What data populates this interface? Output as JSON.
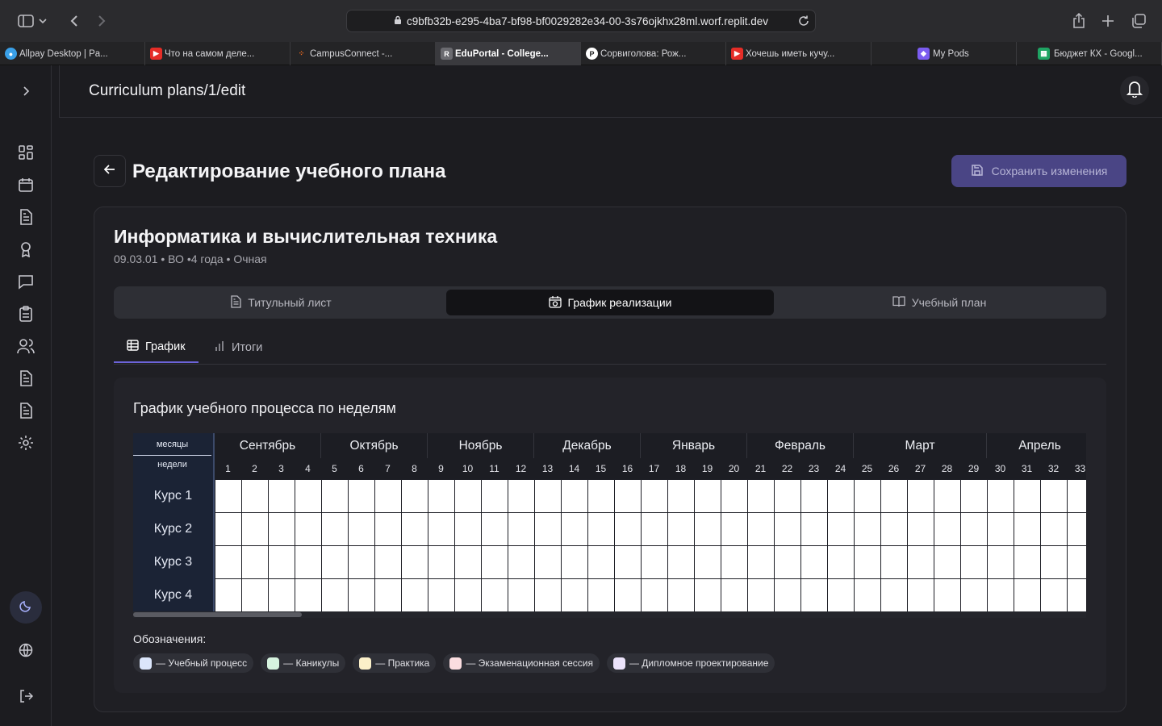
{
  "browser": {
    "url": "c9bfb32b-e295-4ba7-bf98-bf0029282e34-00-3s76ojkhx28ml.worf.replit.dev",
    "tabs": [
      {
        "title": "Allpay Desktop | Pa...",
        "icon": "allpay-icon",
        "color": "#3aa0e8"
      },
      {
        "title": "Что на самом деле...",
        "icon": "youtube-icon",
        "color": "#e52d27"
      },
      {
        "title": "CampusConnect -...",
        "icon": "campus-icon",
        "color": "#f26b1d"
      },
      {
        "title": "EduPortal - College...",
        "icon": "replit-icon",
        "color": "#6b6b70",
        "active": true
      },
      {
        "title": "Сорвиголова: Рож...",
        "icon": "reader-icon",
        "color": "#ffffff"
      },
      {
        "title": "Хочешь иметь кучу...",
        "icon": "youtube-icon",
        "color": "#e52d27"
      },
      {
        "title": "My Pods",
        "icon": "pods-icon",
        "color": "#7b5cf0"
      },
      {
        "title": "Бюджет КХ - Googl...",
        "icon": "sheets-icon",
        "color": "#1fa463"
      }
    ]
  },
  "app": {
    "breadcrumb": "Curriculum plans/1/edit",
    "page_title": "Редактирование учебного плана",
    "save_label": "Сохранить изменения",
    "program": {
      "name": "Информатика и вычислительная техника",
      "meta": "09.03.01 • ВО •4 года • Очная"
    },
    "sections": [
      {
        "label": "Титульный лист",
        "icon": "document-icon"
      },
      {
        "label": "График реализации",
        "icon": "calendar-icon",
        "active": true
      },
      {
        "label": "Учебный план",
        "icon": "book-icon"
      }
    ],
    "subtabs": [
      {
        "label": "График",
        "icon": "table-icon",
        "active": true
      },
      {
        "label": "Итоги",
        "icon": "bar-chart-icon"
      }
    ],
    "schedule": {
      "title": "График учебного процесса по неделям",
      "months_label": "месяцы",
      "weeks_label": "недели",
      "months": [
        {
          "name": "Сентябрь",
          "weeks": 4
        },
        {
          "name": "Октябрь",
          "weeks": 4
        },
        {
          "name": "Ноябрь",
          "weeks": 4
        },
        {
          "name": "Декабрь",
          "weeks": 4
        },
        {
          "name": "Январь",
          "weeks": 4
        },
        {
          "name": "Февраль",
          "weeks": 4
        },
        {
          "name": "Март",
          "weeks": 5
        },
        {
          "name": "Апрель",
          "weeks": 4
        }
      ],
      "weeks": [
        "1",
        "2",
        "3",
        "4",
        "5",
        "6",
        "7",
        "8",
        "9",
        "10",
        "11",
        "12",
        "13",
        "14",
        "15",
        "16",
        "17",
        "18",
        "19",
        "20",
        "21",
        "22",
        "23",
        "24",
        "25",
        "26",
        "27",
        "28",
        "29",
        "30",
        "31",
        "32",
        "33"
      ],
      "courses": [
        "Курс 1",
        "Курс 2",
        "Курс 3",
        "Курс 4"
      ]
    },
    "legend": {
      "title": "Обозначения:",
      "items": [
        {
          "label": "— Учебный процесс",
          "color": "#dbe6fb"
        },
        {
          "label": "— Каникулы",
          "color": "#d6f3df"
        },
        {
          "label": "— Практика",
          "color": "#fbf0c9"
        },
        {
          "label": "— Экзаменационная сессия",
          "color": "#fbdde0"
        },
        {
          "label": "— Дипломное проектирование",
          "color": "#ece3fb"
        }
      ]
    }
  }
}
